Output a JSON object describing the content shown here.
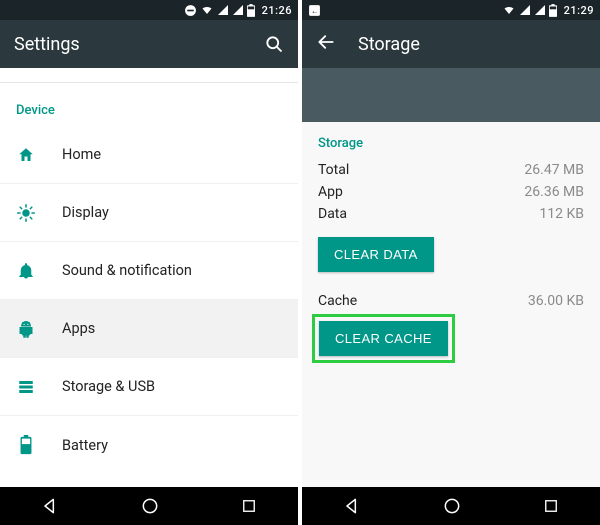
{
  "colors": {
    "teal": "#009688",
    "appbar": "#2b393f",
    "status": "#1b2428"
  },
  "left": {
    "status": {
      "time": "21:26"
    },
    "title": "Settings",
    "section": "Device",
    "items": [
      {
        "icon": "home-icon",
        "label": "Home"
      },
      {
        "icon": "display-icon",
        "label": "Display"
      },
      {
        "icon": "bell-icon",
        "label": "Sound & notification"
      },
      {
        "icon": "android-icon",
        "label": "Apps",
        "selected": true
      },
      {
        "icon": "storage-icon",
        "label": "Storage & USB"
      },
      {
        "icon": "battery-icon",
        "label": "Battery"
      }
    ]
  },
  "right": {
    "status": {
      "time": "21:29"
    },
    "title": "Storage",
    "section": "Storage",
    "rows": {
      "total": {
        "label": "Total",
        "value": "26.47 MB"
      },
      "app": {
        "label": "App",
        "value": "26.36 MB"
      },
      "data": {
        "label": "Data",
        "value": "112 KB"
      },
      "cache": {
        "label": "Cache",
        "value": "36.00 KB"
      }
    },
    "buttons": {
      "clear_data": "CLEAR DATA",
      "clear_cache": "CLEAR CACHE"
    }
  }
}
